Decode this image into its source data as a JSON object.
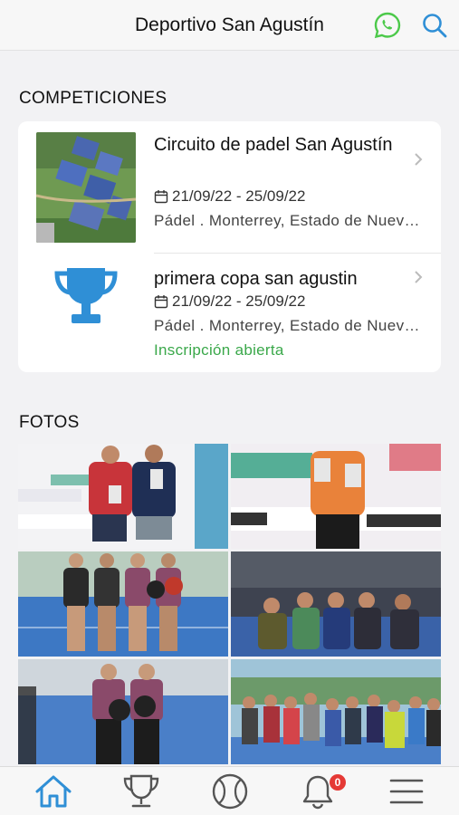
{
  "header": {
    "title": "Deportivo San Agustín"
  },
  "sections": {
    "competitions": "COMPETICIONES",
    "photos": "FOTOS"
  },
  "competitions": [
    {
      "name": "Circuito de padel San Agustín",
      "dates": "21/09/22 - 25/09/22",
      "location": "Pádel . Monterrey, Estado de Nuevo León",
      "status": ""
    },
    {
      "name": "primera copa san agustin",
      "dates": "21/09/22 - 25/09/22",
      "location": "Pádel . Monterrey, Estado de Nuevo León",
      "status": "Inscripción abierta"
    }
  ],
  "photo_count": 6,
  "tabbar": {
    "notifications_badge": "0"
  },
  "colors": {
    "accent": "#2f8fd6",
    "status_green": "#3aa84a",
    "whatsapp": "#4cc94a",
    "badge": "#e53935"
  },
  "icons": [
    "whatsapp-icon",
    "search-icon",
    "calendar-icon",
    "trophy-icon",
    "chevron-right-icon",
    "home-icon",
    "trophy-tab-icon",
    "tennis-ball-icon",
    "bell-icon",
    "menu-icon"
  ]
}
